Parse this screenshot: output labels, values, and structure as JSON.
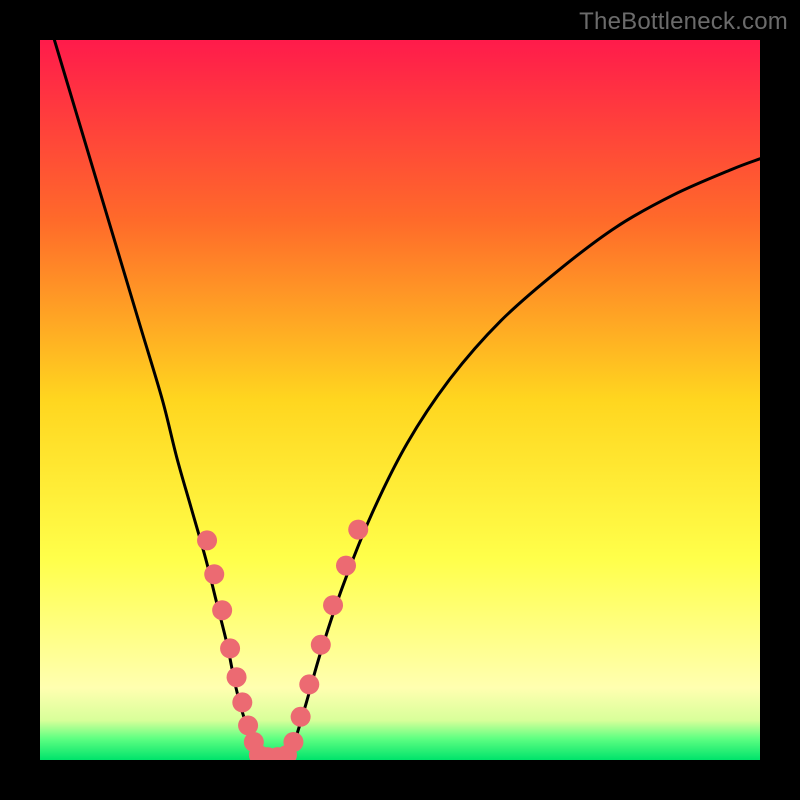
{
  "watermark": "TheBottleneck.com",
  "chart_data": {
    "type": "line",
    "title": "",
    "xlabel": "",
    "ylabel": "",
    "xlim": [
      0,
      100
    ],
    "ylim": [
      0,
      100
    ],
    "background_gradient": {
      "stops": [
        {
          "offset": 0.0,
          "color": "#ff1b4b"
        },
        {
          "offset": 0.25,
          "color": "#ff6a2a"
        },
        {
          "offset": 0.5,
          "color": "#ffd61f"
        },
        {
          "offset": 0.72,
          "color": "#ffff4a"
        },
        {
          "offset": 0.9,
          "color": "#ffffb0"
        },
        {
          "offset": 0.945,
          "color": "#d8ff9a"
        },
        {
          "offset": 0.97,
          "color": "#5fff82"
        },
        {
          "offset": 1.0,
          "color": "#00e36b"
        }
      ]
    },
    "series": [
      {
        "name": "left-branch",
        "color": "#000000",
        "x": [
          2,
          5,
          8,
          11,
          14,
          17,
          19,
          21,
          23,
          24.5,
          26,
          27,
          28,
          29,
          29.8,
          30.5
        ],
        "y": [
          100,
          90,
          80,
          70,
          60,
          50,
          42,
          35,
          28,
          22,
          16,
          11,
          7,
          4,
          2,
          0.5
        ]
      },
      {
        "name": "right-branch",
        "color": "#000000",
        "x": [
          34.5,
          35.5,
          37,
          39,
          42,
          46,
          51,
          57,
          64,
          72,
          80,
          88,
          96,
          100
        ],
        "y": [
          0.5,
          3,
          8,
          15,
          24,
          34,
          44,
          53,
          61,
          68,
          74,
          78.5,
          82,
          83.5
        ]
      }
    ],
    "markers": [
      {
        "name": "left-dots",
        "color": "#ec6a72",
        "radius": 10,
        "points": [
          {
            "x": 23.2,
            "y": 30.5
          },
          {
            "x": 24.2,
            "y": 25.8
          },
          {
            "x": 25.3,
            "y": 20.8
          },
          {
            "x": 26.4,
            "y": 15.5
          },
          {
            "x": 27.3,
            "y": 11.5
          },
          {
            "x": 28.1,
            "y": 8.0
          },
          {
            "x": 28.9,
            "y": 4.8
          },
          {
            "x": 29.7,
            "y": 2.5
          }
        ]
      },
      {
        "name": "right-dots",
        "color": "#ec6a72",
        "radius": 10,
        "points": [
          {
            "x": 35.2,
            "y": 2.5
          },
          {
            "x": 36.2,
            "y": 6.0
          },
          {
            "x": 37.4,
            "y": 10.5
          },
          {
            "x": 39.0,
            "y": 16.0
          },
          {
            "x": 40.7,
            "y": 21.5
          },
          {
            "x": 42.5,
            "y": 27.0
          },
          {
            "x": 44.2,
            "y": 32.0
          }
        ]
      },
      {
        "name": "bottom-dots",
        "color": "#ec6a72",
        "radius": 10,
        "points": [
          {
            "x": 30.4,
            "y": 0.7
          },
          {
            "x": 31.6,
            "y": 0.4
          },
          {
            "x": 33.0,
            "y": 0.4
          },
          {
            "x": 34.3,
            "y": 0.7
          }
        ]
      }
    ]
  }
}
